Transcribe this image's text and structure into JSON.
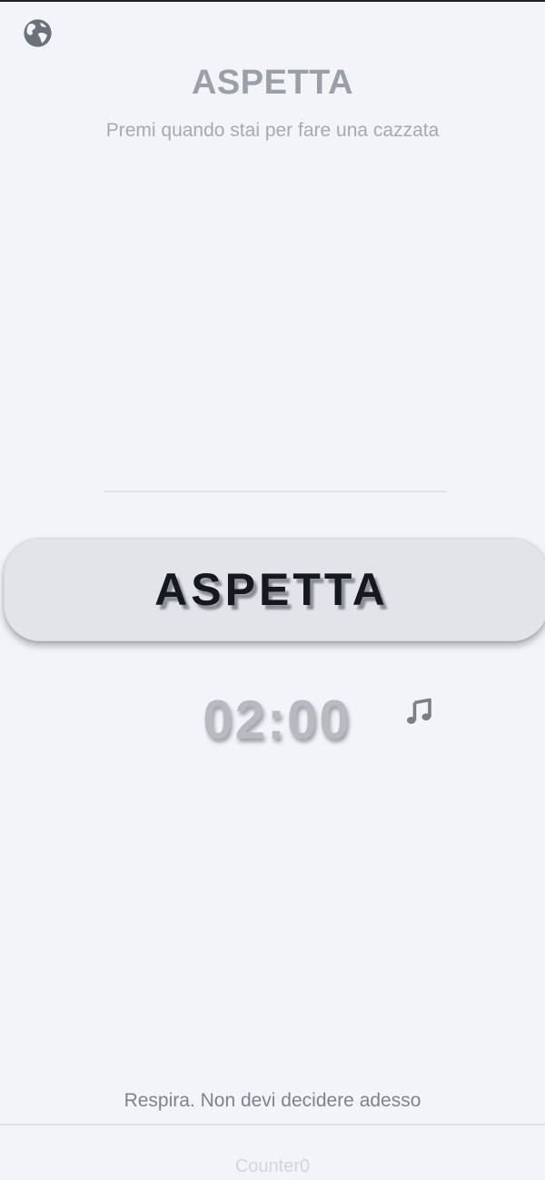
{
  "header": {
    "title": "ASPETTA",
    "subtitle": "Premi quando stai per fare una cazzata"
  },
  "main": {
    "button_label": "ASPETTA",
    "timer": "02:00"
  },
  "footer": {
    "message": "Respira. Non devi decidere adesso",
    "counter": "Counter0"
  },
  "icons": {
    "language": "globe-icon",
    "sound": "music-note-icon"
  },
  "colors": {
    "background": "#f2f4f8",
    "button": "#e2e4e8",
    "button_text": "#15181c",
    "muted_text": "#9aa0a6"
  }
}
